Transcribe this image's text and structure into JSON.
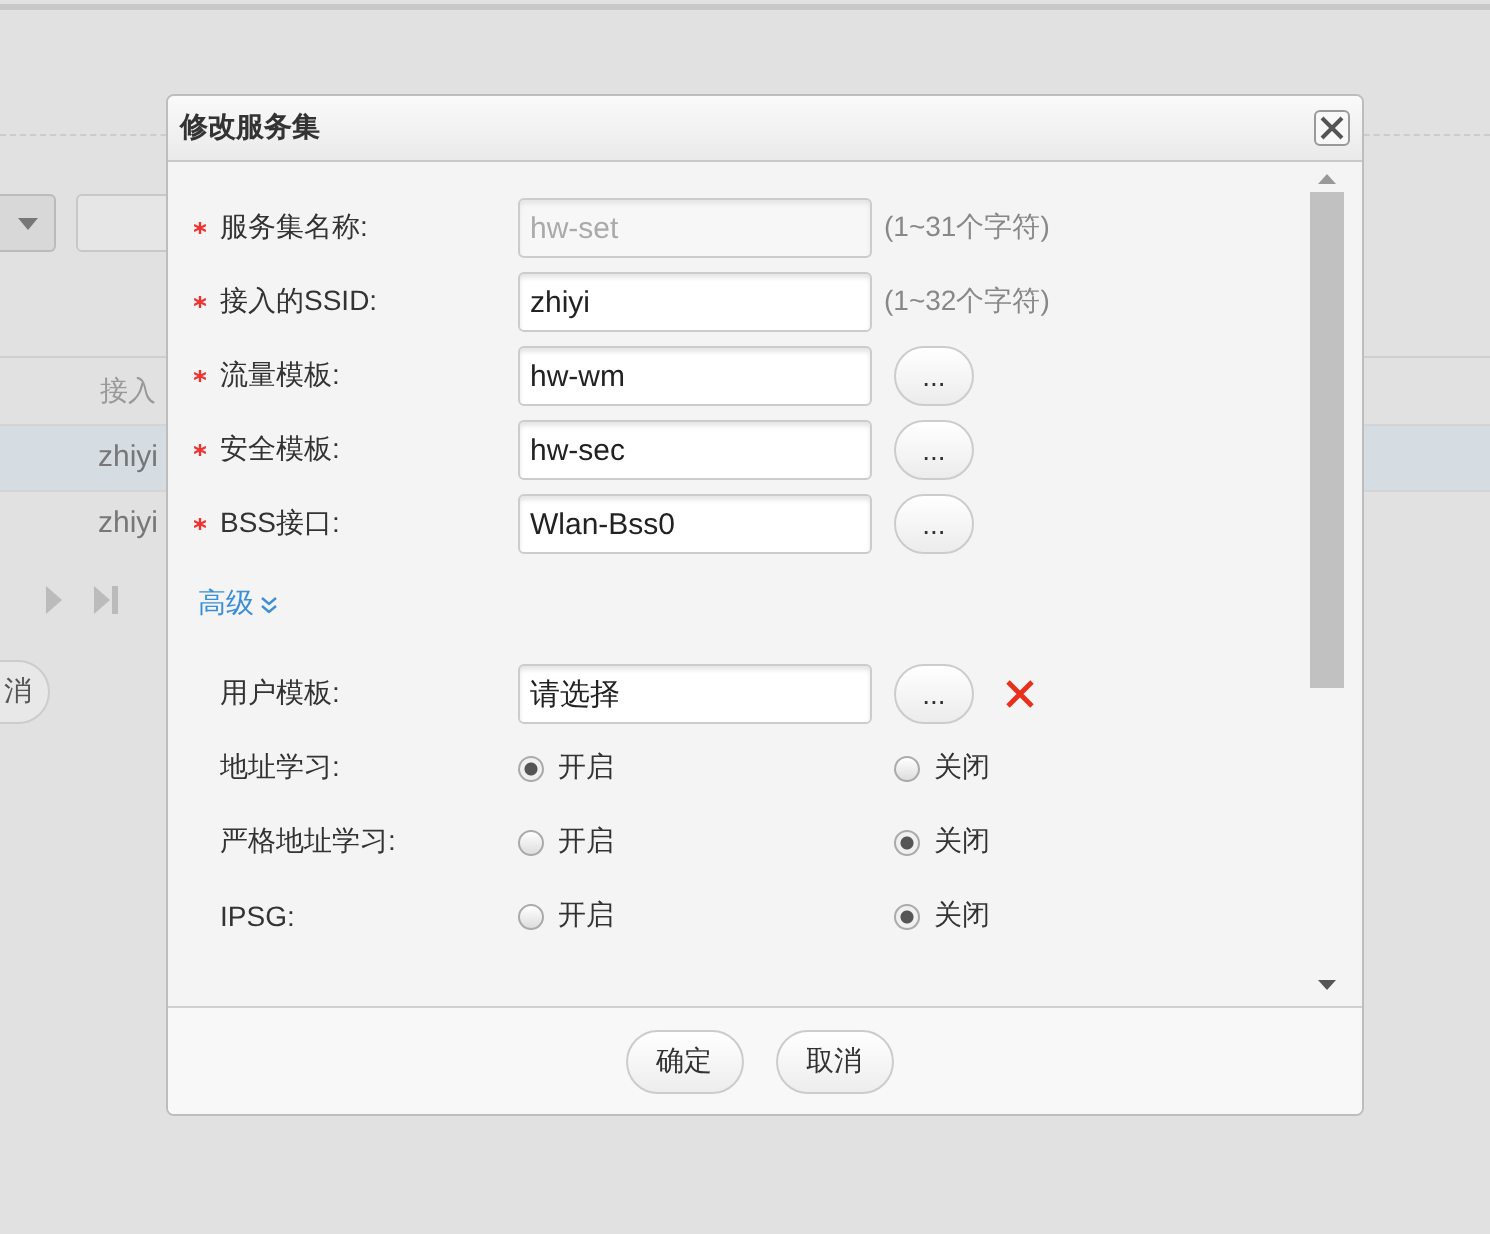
{
  "background": {
    "column_header": "接入",
    "rows": [
      {
        "text": "zhiyi",
        "selected": true
      },
      {
        "text": "zhiyi",
        "selected": false
      }
    ],
    "button": "消"
  },
  "dialog": {
    "title": "修改服务集",
    "basic_fields": [
      {
        "label": "服务集名称:",
        "required": true,
        "value": "hw-set",
        "disabled": true,
        "hint": "(1~31个字符)"
      },
      {
        "label": "接入的SSID:",
        "required": true,
        "value": "zhiyi",
        "disabled": false,
        "hint": "(1~32个字符)"
      },
      {
        "label": "流量模板:",
        "required": true,
        "value": "hw-wm",
        "disabled": false,
        "browse": "..."
      },
      {
        "label": "安全模板:",
        "required": true,
        "value": "hw-sec",
        "disabled": false,
        "browse": "..."
      },
      {
        "label": "BSS接口:",
        "required": true,
        "value": "Wlan-Bss0",
        "disabled": false,
        "browse": "..."
      }
    ],
    "advanced": "高级",
    "advanced_fields": [
      {
        "label": "用户模板:",
        "value": "请选择",
        "disabled": false,
        "browse": "...",
        "clearable": true
      }
    ],
    "radio_rows": [
      {
        "label": "地址学习:",
        "options": [
          {
            "label": "开启",
            "selected": true
          },
          {
            "label": "关闭",
            "selected": false
          }
        ]
      },
      {
        "label": "严格地址学习:",
        "options": [
          {
            "label": "开启",
            "selected": false
          },
          {
            "label": "关闭",
            "selected": true
          }
        ]
      },
      {
        "label": "IPSG:",
        "options": [
          {
            "label": "开启",
            "selected": false
          },
          {
            "label": "关闭",
            "selected": true
          }
        ]
      }
    ],
    "buttons": [
      "确定",
      "取消"
    ]
  }
}
